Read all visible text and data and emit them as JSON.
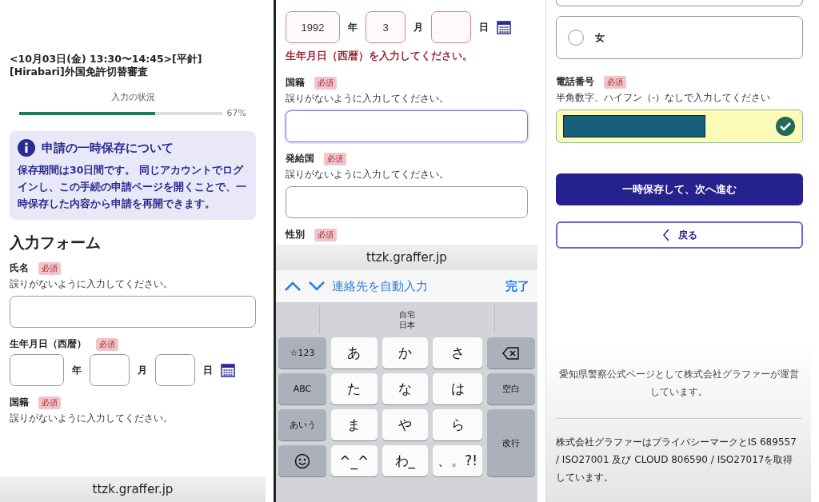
{
  "screen_start": {
    "title": "<10月03日(金) 13:30〜14:45>[平針][Hirabari]外国免許切替審査",
    "progress": {
      "label": "入力の状況",
      "level": 0.67,
      "reading": "67%"
    },
    "notice": {
      "title": "申請の一時保存について",
      "body": "保存期間は30日間です。 同じアカウントでログインし、この手続の申請ページを開くことで、一時保存した内容から申請を再開できます。"
    },
    "form_heading": "入力フォーム",
    "fields": [
      {
        "kind": "text",
        "label": "氏名",
        "badge": "必須",
        "hint": "誤りがないように入力してください。",
        "focused": false
      },
      {
        "kind": "date",
        "label": "生年月日（西暦）",
        "badge": "必須",
        "error": false,
        "parts": [
          {
            "unit": "年"
          },
          {
            "unit": "月"
          },
          {
            "unit": "日"
          }
        ]
      },
      {
        "kind": "label",
        "label": "国籍",
        "badge": "必須",
        "hint": "誤りがないように入力してください。"
      }
    ],
    "url": "ttzk.graffer.jp"
  },
  "screen_keyboard": {
    "fields": [
      {
        "kind": "date",
        "error": true,
        "error_message": "生年月日（西暦）を入力してください。",
        "parts": [
          {
            "value": "1992",
            "unit": "年"
          },
          {
            "value": "3",
            "unit": "月"
          },
          {
            "unit": "日"
          }
        ]
      },
      {
        "kind": "text",
        "label": "国籍",
        "badge": "必須",
        "hint": "誤りがないように入力してください。",
        "focused": true
      },
      {
        "kind": "text",
        "label": "発給国",
        "badge": "必須",
        "hint": "誤りがないように入力してください。",
        "focused": false
      },
      {
        "kind": "label",
        "label": "性別",
        "badge": "必須"
      }
    ],
    "url": "ttzk.graffer.jp",
    "accessory": {
      "autofill": "連絡先を自動入力",
      "done": "完了"
    },
    "suggestion": {
      "line_1": "自宅",
      "line_2": "日本"
    },
    "keys": [
      {
        "kind": "func",
        "label": "☆123"
      },
      {
        "kind": "char",
        "label": "あ"
      },
      {
        "kind": "char",
        "label": "か"
      },
      {
        "kind": "char",
        "label": "さ"
      },
      {
        "kind": "delete"
      },
      {
        "kind": "func",
        "label": "ABC"
      },
      {
        "kind": "char",
        "label": "た"
      },
      {
        "kind": "char",
        "label": "な"
      },
      {
        "kind": "char",
        "label": "は"
      },
      {
        "kind": "func",
        "label": "空白"
      },
      {
        "kind": "func",
        "label": "あいう"
      },
      {
        "kind": "char",
        "label": "ま"
      },
      {
        "kind": "char",
        "label": "や"
      },
      {
        "kind": "char",
        "label": "ら"
      },
      {
        "kind": "return",
        "label": "改行"
      },
      {
        "kind": "emoji"
      },
      {
        "kind": "char",
        "label": "^_^"
      },
      {
        "kind": "char",
        "label": "わ_"
      },
      {
        "kind": "char",
        "label": "、。?!"
      }
    ]
  },
  "screen_end": {
    "options": [
      {
        "label": "女",
        "selected": false
      }
    ],
    "phone": {
      "label": "電話番号",
      "badge": "必須",
      "hint": "半角数字、ハイフン（-）なしで入力してください",
      "valid": true
    },
    "primary_button": "一時保存して、次へ進む",
    "back_button": "戻る",
    "operator_note": "愛知県警察公式ページとして株式会社グラファーが運営しています。",
    "certification": "株式会社グラファーはプライバシーマークとIS 689557 / ISO27001 及び CLOUD 806590 / ISO27017を取得しています。"
  }
}
